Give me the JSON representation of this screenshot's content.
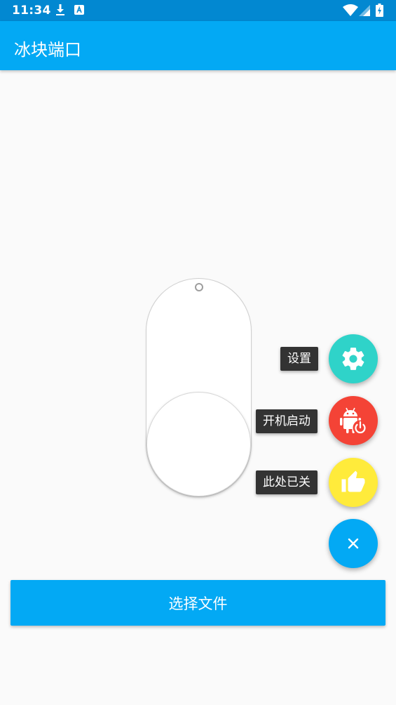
{
  "status_bar": {
    "time": "11:34",
    "icons": [
      "download-icon",
      "app-notification-icon",
      "wifi-icon",
      "signal-icon",
      "battery-charging-icon"
    ]
  },
  "app_bar": {
    "title": "冰块端口"
  },
  "switch": {
    "state": "off"
  },
  "fab_menu": {
    "items": [
      {
        "label": "设置",
        "icon": "gear-icon",
        "color": "#2fd3c9"
      },
      {
        "label": "开机启动",
        "icon": "android-power-icon",
        "color": "#f44336"
      },
      {
        "label": "此处已关",
        "icon": "thumbs-up-icon",
        "color": "#ffeb3b"
      }
    ],
    "main": {
      "icon": "close-icon",
      "color": "#03a9f4"
    }
  },
  "select_button": {
    "label": "选择文件"
  },
  "colors": {
    "status_bar": "#0288d1",
    "primary": "#03a9f4",
    "background": "#fafafa"
  }
}
